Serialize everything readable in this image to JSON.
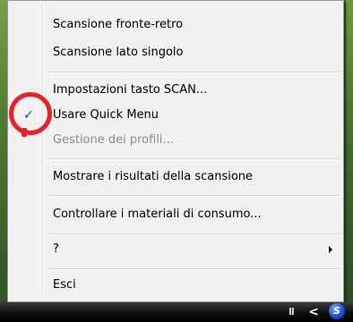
{
  "context_menu": {
    "items": [
      {
        "label": "Scansione fronte-retro"
      },
      {
        "label": "Scansione lato singolo"
      },
      {
        "label": "Impostazioni tasto SCAN..."
      },
      {
        "label": "Usare Quick Menu",
        "checked": true
      },
      {
        "label": "Gestione dei profili...",
        "disabled": true
      },
      {
        "label": "Mostrare i risultati della scansione"
      },
      {
        "label": "Controllare i materiali di consumo..."
      },
      {
        "label": "?",
        "has_submenu": true
      },
      {
        "label": "Esci"
      }
    ],
    "check_glyph": "✓",
    "highlight_color": "#e8202a"
  },
  "taskbar": {
    "pause_glyph": "II",
    "chevron_glyph": "<",
    "tray_icon_letter": "S"
  }
}
